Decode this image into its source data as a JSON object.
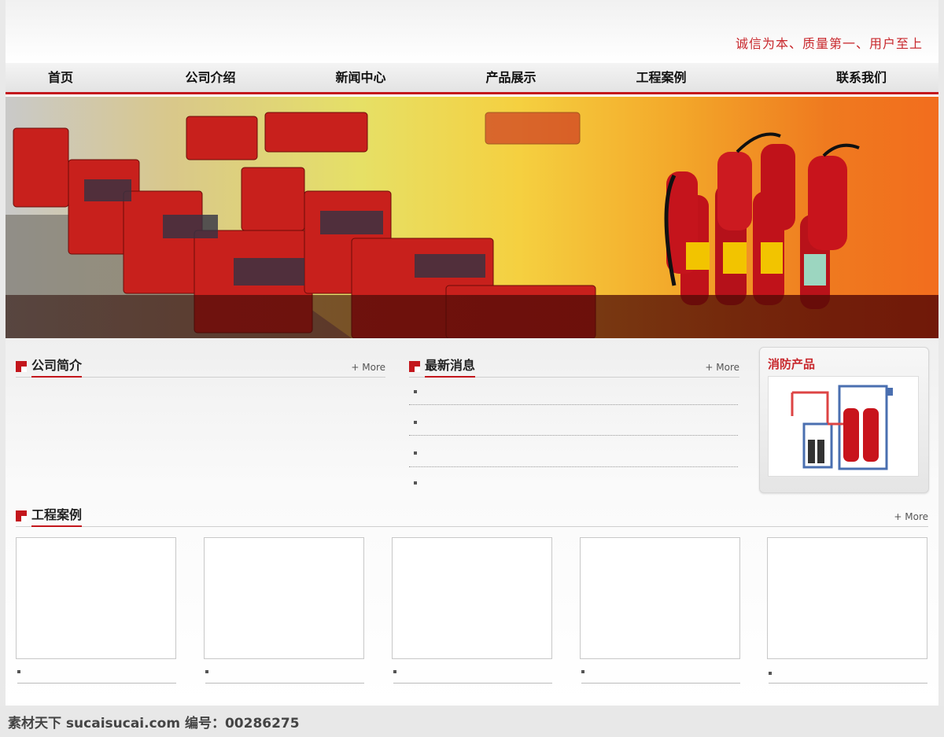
{
  "header": {
    "slogan": "诚信为本、质量第一、用户至上"
  },
  "nav": {
    "items": [
      "首页",
      "公司介绍",
      "新闻中心",
      "产品展示",
      "工程案例",
      "联系我们"
    ]
  },
  "sections": {
    "company": {
      "title": "公司简介",
      "more": "+ More"
    },
    "news": {
      "title": "最新消息",
      "more": "+ More"
    },
    "products": {
      "title": "消防产品"
    },
    "cases": {
      "title": "工程案例",
      "more": "+ More"
    }
  },
  "colors": {
    "accent": "#c3161c",
    "slogan": "#c8282d"
  },
  "footer": {
    "watermark": "素材天下 sucaisucai.com  编号：00286275"
  }
}
